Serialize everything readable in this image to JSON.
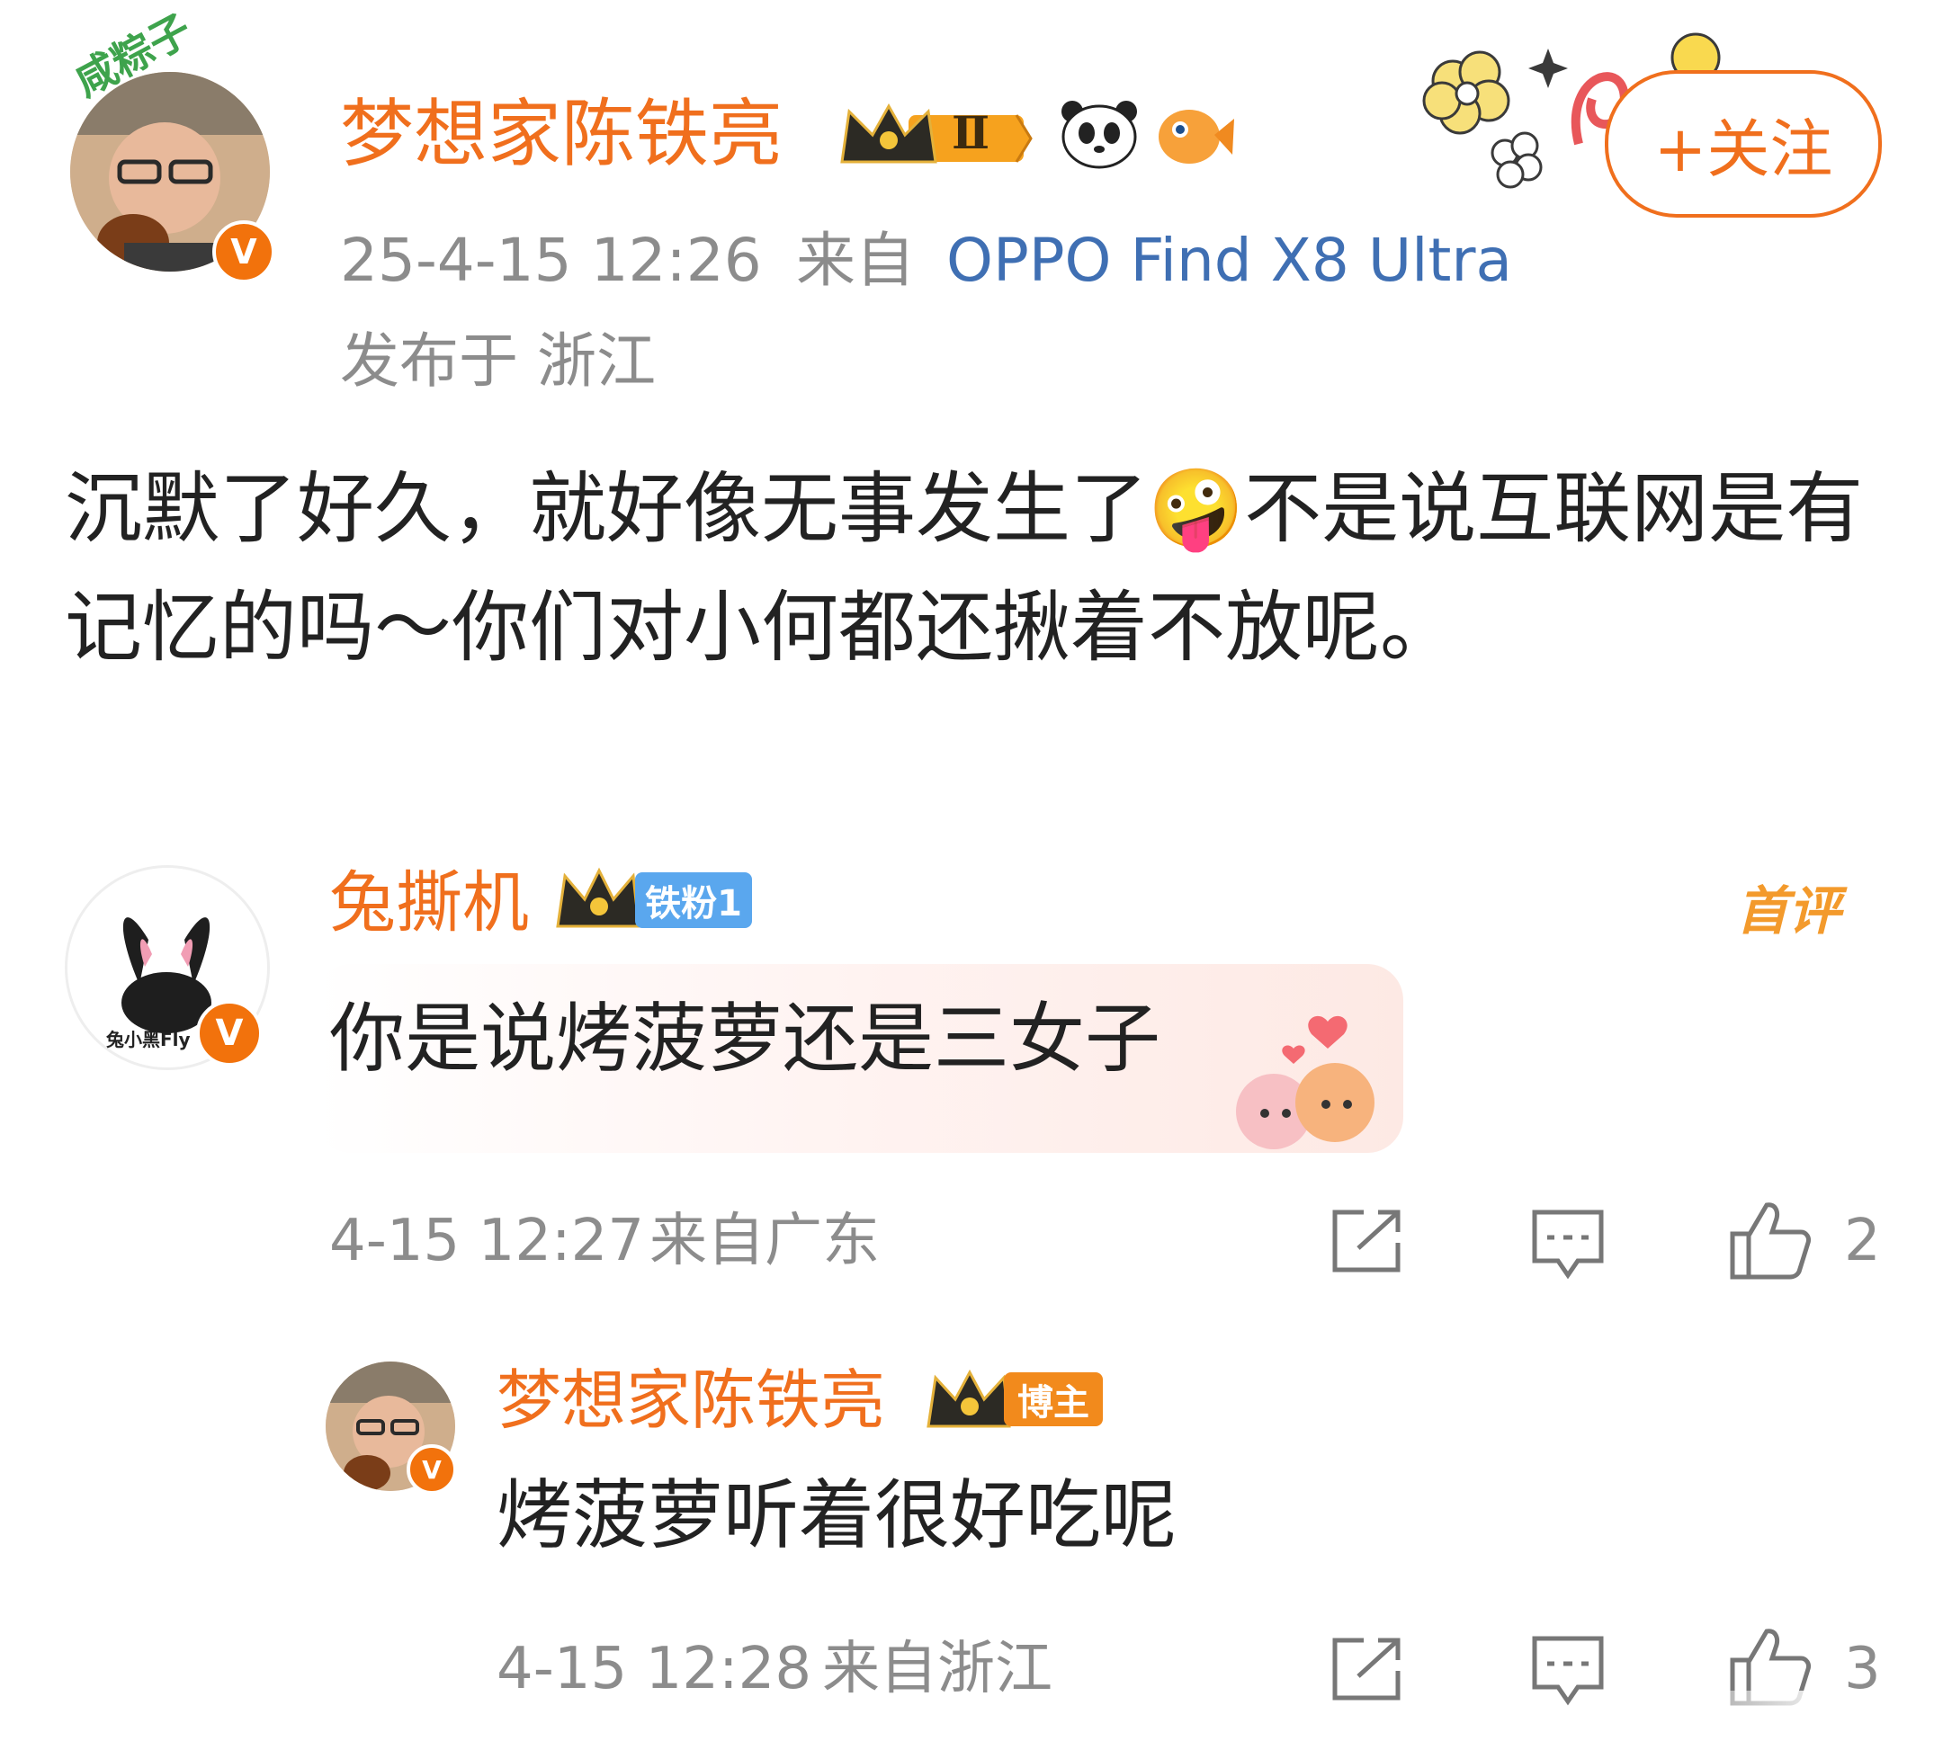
{
  "post": {
    "author": "梦想家陈铁亮",
    "avatar_decoration_text": "咸粽子",
    "level_mark": "Ⅱ",
    "timestamp": "25-4-15 12:26",
    "source_prefix": "来自",
    "device": "OPPO Find X8 Ultra",
    "location": "发布于 浙江",
    "follow_label": "+关注",
    "text": "沉默了好久，就好像无事发生了🤪不是说互联网是有记忆的吗～你们对小何都还揪着不放呢。"
  },
  "comments": [
    {
      "author": "兔撕机",
      "tag": "铁粉1",
      "avatar_caption": "兔小黑Fly",
      "badge": "首评",
      "text": "你是说烤菠萝还是三女子",
      "time": "4-15 12:27",
      "source": "来自广东",
      "likes": "2"
    },
    {
      "author": "梦想家陈铁亮",
      "tag": "博主",
      "text": "烤菠萝听着很好吃呢",
      "time": "4-15 12:28",
      "source": "来自浙江",
      "likes": "3"
    }
  ],
  "colors": {
    "brand_orange": "#f06f1d",
    "link_blue": "#3f6fb3",
    "meta_gray": "#8c8c8c",
    "fan_tag_blue": "#5aa7ee",
    "host_tag_orange": "#f28a1c"
  },
  "icons": [
    "crown-icon",
    "panda-icon",
    "fish-icon",
    "v-verified-icon",
    "share-icon",
    "comment-icon",
    "like-icon"
  ]
}
